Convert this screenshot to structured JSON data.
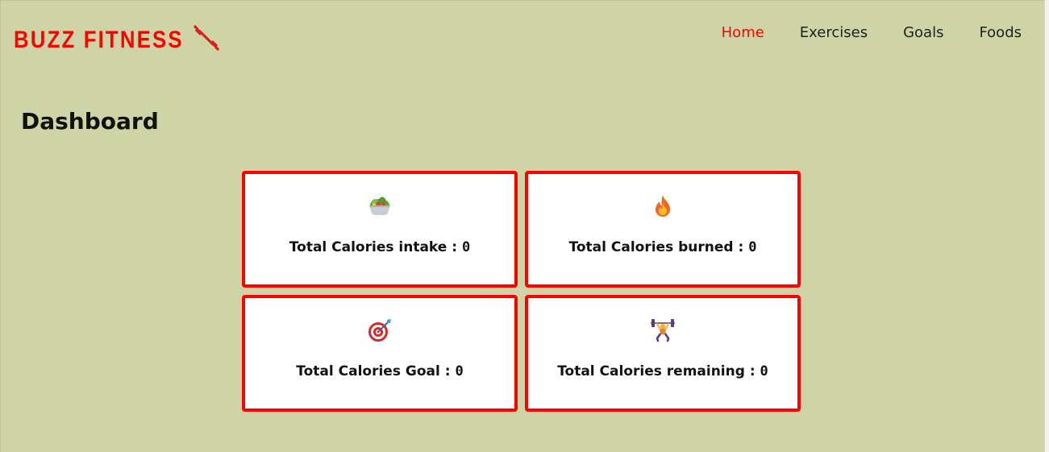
{
  "brand": {
    "name": "BUZZ FITNESS",
    "icon": "dumbbell-icon",
    "color": "#ff0000"
  },
  "nav": {
    "items": [
      {
        "label": "Home",
        "active": true
      },
      {
        "label": "Exercises",
        "active": false
      },
      {
        "label": "Goals",
        "active": false
      },
      {
        "label": "Foods",
        "active": false
      }
    ]
  },
  "page": {
    "title": "Dashboard",
    "background": "#cfd4a6"
  },
  "cards": [
    {
      "icon": "salad-icon",
      "label": "Total Calories intake :",
      "value": "0"
    },
    {
      "icon": "fire-icon",
      "label": "Total Calories burned :",
      "value": "0"
    },
    {
      "icon": "target-icon",
      "label": "Total Calories Goal :",
      "value": "0"
    },
    {
      "icon": "weightlifter-icon",
      "label": "Total Calories remaining :",
      "value": "0"
    }
  ],
  "colors": {
    "accent": "#ff0000",
    "card_background": "#ffffff",
    "text": "#111111"
  }
}
